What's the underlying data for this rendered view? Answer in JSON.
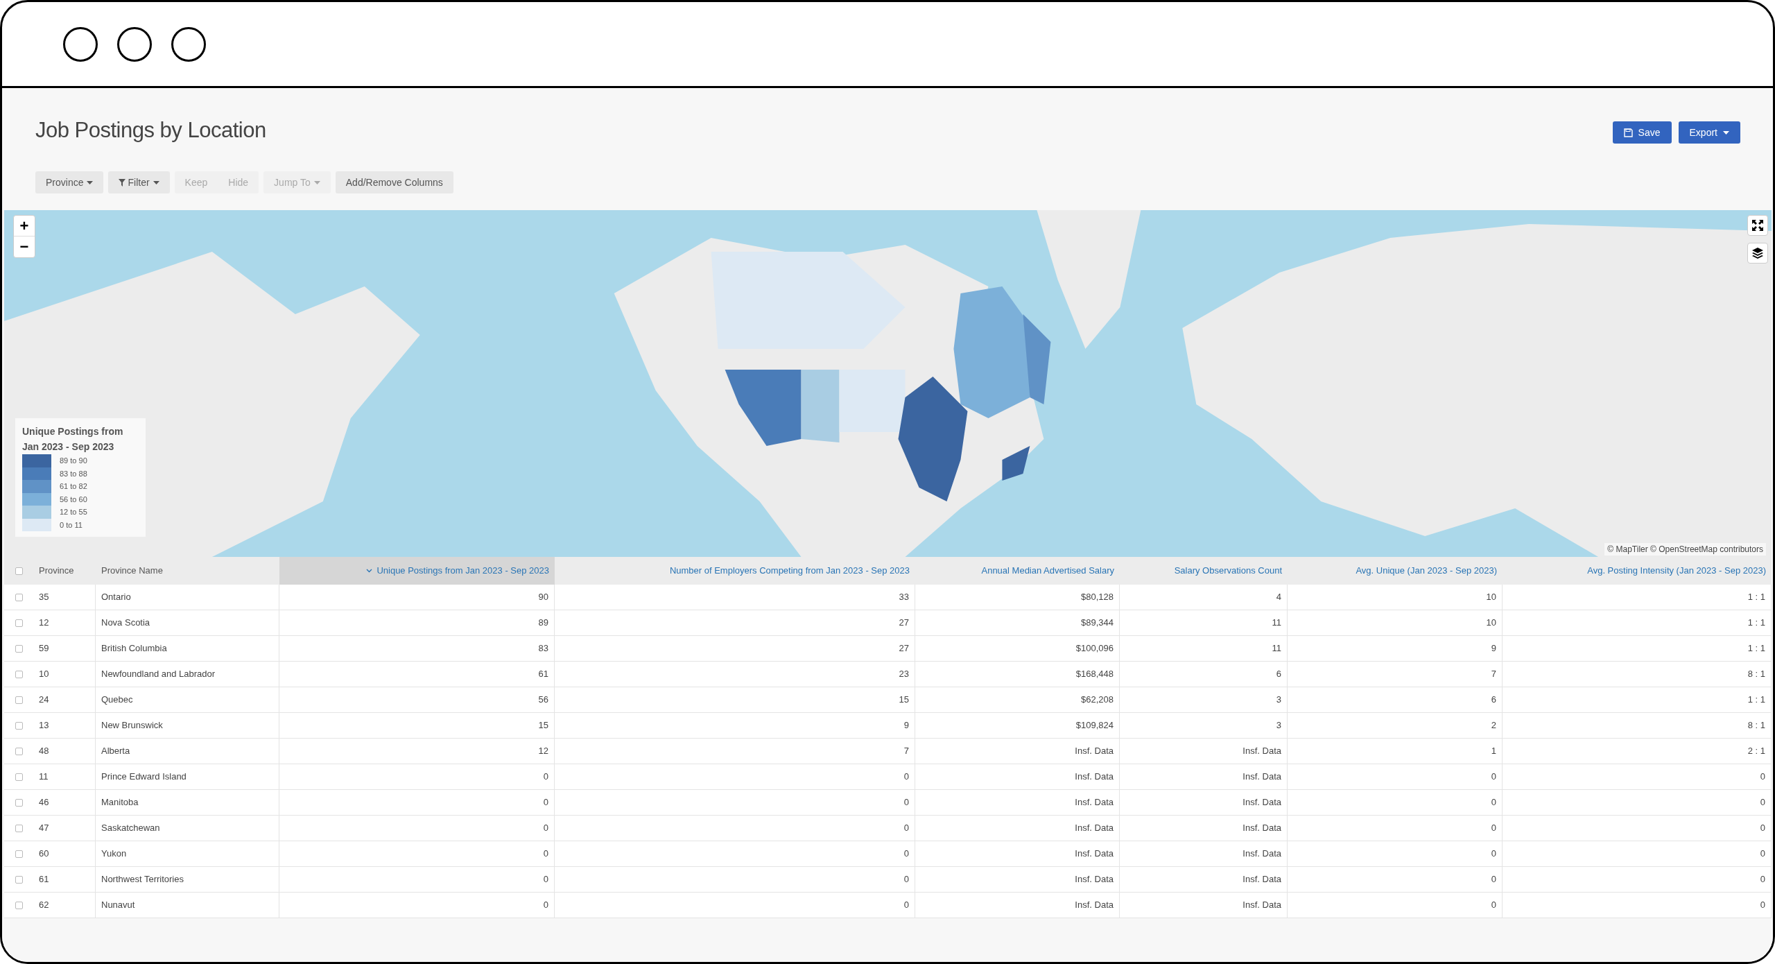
{
  "page": {
    "title": "Job Postings by Location",
    "actions": [
      {
        "label": "Save",
        "kind": "save"
      },
      {
        "label": "Export",
        "kind": "dropdown"
      }
    ]
  },
  "toolbar": [
    {
      "buttons": [
        {
          "label": "Province",
          "kind": "dropdown",
          "disabled": false
        }
      ]
    },
    {
      "buttons": [
        {
          "label": "Filter",
          "kind": "filter",
          "disabled": false
        }
      ]
    },
    {
      "buttons": [
        {
          "label": "Keep",
          "kind": "plain",
          "disabled": true
        },
        {
          "label": "Hide",
          "kind": "plain",
          "disabled": true
        }
      ]
    },
    {
      "buttons": [
        {
          "label": "Jump To",
          "kind": "dropdown",
          "disabled": true
        }
      ]
    },
    {
      "buttons": [
        {
          "label": "Add/Remove Columns",
          "kind": "plain",
          "disabled": false
        }
      ]
    }
  ],
  "map": {
    "zoom_controls": [
      "+",
      "−"
    ],
    "legend": {
      "title": "Unique Postings from Jan 2023 - Sep 2023",
      "items": [
        {
          "label": "89 to 90",
          "color": "#3b65a0"
        },
        {
          "label": "83 to 88",
          "color": "#4a7cb8"
        },
        {
          "label": "61 to 82",
          "color": "#6092c6"
        },
        {
          "label": "56 to 60",
          "color": "#7cb0d9"
        },
        {
          "label": "12 to 55",
          "color": "#a9cde3"
        },
        {
          "label": "0 to 11",
          "color": "#dde9f4"
        }
      ]
    },
    "attribution": "© MapTiler © OpenStreetMap contributors"
  },
  "table": {
    "select_all_checked": false,
    "columns": [
      {
        "label": "Province",
        "kind": "text",
        "sorted": false
      },
      {
        "label": "Province Name",
        "kind": "text",
        "sorted": false
      },
      {
        "label": "Unique Postings from Jan 2023 - Sep 2023",
        "kind": "numeric",
        "sorted": true
      },
      {
        "label": "Number of Employers Competing from Jan 2023 - Sep 2023",
        "kind": "numeric",
        "sorted": false
      },
      {
        "label": "Annual Median Advertised Salary",
        "kind": "numeric",
        "sorted": false
      },
      {
        "label": "Salary Observations Count",
        "kind": "numeric",
        "sorted": false
      },
      {
        "label": "Avg. Unique (Jan 2023 - Sep 2023)",
        "kind": "numeric",
        "sorted": false
      },
      {
        "label": "Avg. Posting Intensity (Jan 2023 - Sep 2023)",
        "kind": "numeric",
        "sorted": false
      }
    ],
    "rows": [
      {
        "checked": false,
        "cells": [
          "35",
          "Ontario",
          "90",
          "33",
          "$80,128",
          "4",
          "10",
          "1 : 1"
        ]
      },
      {
        "checked": false,
        "cells": [
          "12",
          "Nova Scotia",
          "89",
          "27",
          "$89,344",
          "11",
          "10",
          "1 : 1"
        ]
      },
      {
        "checked": false,
        "cells": [
          "59",
          "British Columbia",
          "83",
          "27",
          "$100,096",
          "11",
          "9",
          "1 : 1"
        ]
      },
      {
        "checked": false,
        "cells": [
          "10",
          "Newfoundland and Labrador",
          "61",
          "23",
          "$168,448",
          "6",
          "7",
          "8 : 1"
        ]
      },
      {
        "checked": false,
        "cells": [
          "24",
          "Quebec",
          "56",
          "15",
          "$62,208",
          "3",
          "6",
          "1 : 1"
        ]
      },
      {
        "checked": false,
        "cells": [
          "13",
          "New Brunswick",
          "15",
          "9",
          "$109,824",
          "3",
          "2",
          "8 : 1"
        ]
      },
      {
        "checked": false,
        "cells": [
          "48",
          "Alberta",
          "12",
          "7",
          "Insf. Data",
          "Insf. Data",
          "1",
          "2 : 1"
        ]
      },
      {
        "checked": false,
        "cells": [
          "11",
          "Prince Edward Island",
          "0",
          "0",
          "Insf. Data",
          "Insf. Data",
          "0",
          "0"
        ]
      },
      {
        "checked": false,
        "cells": [
          "46",
          "Manitoba",
          "0",
          "0",
          "Insf. Data",
          "Insf. Data",
          "0",
          "0"
        ]
      },
      {
        "checked": false,
        "cells": [
          "47",
          "Saskatchewan",
          "0",
          "0",
          "Insf. Data",
          "Insf. Data",
          "0",
          "0"
        ]
      },
      {
        "checked": false,
        "cells": [
          "60",
          "Yukon",
          "0",
          "0",
          "Insf. Data",
          "Insf. Data",
          "0",
          "0"
        ]
      },
      {
        "checked": false,
        "cells": [
          "61",
          "Northwest Territories",
          "0",
          "0",
          "Insf. Data",
          "Insf. Data",
          "0",
          "0"
        ]
      },
      {
        "checked": false,
        "cells": [
          "62",
          "Nunavut",
          "0",
          "0",
          "Insf. Data",
          "Insf. Data",
          "0",
          "0"
        ]
      }
    ]
  }
}
